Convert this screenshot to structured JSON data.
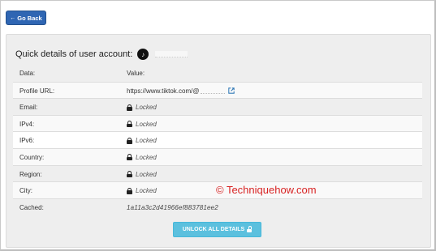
{
  "nav": {
    "back_label": "Go Back",
    "back_icon": "arrow-left-icon"
  },
  "panel": {
    "title": "Quick details of user account:",
    "account_logo": "tiktok-logo",
    "rows": [
      {
        "key": "Data:",
        "value": "Value:"
      },
      {
        "key": "Profile URL:",
        "value": "https://www.tiktok.com/@"
      },
      {
        "key": "Email:",
        "value": "Locked"
      },
      {
        "key": "IPv4:",
        "value": "Locked"
      },
      {
        "key": "IPv6:",
        "value": "Locked"
      },
      {
        "key": "Country:",
        "value": "Locked"
      },
      {
        "key": "Region:",
        "value": "Locked"
      },
      {
        "key": "City:",
        "value": "Locked"
      },
      {
        "key": "Cached:",
        "value": "1a11a3c2d41966ef883781ee2"
      }
    ],
    "unlock_label": "UNLOCK ALL DETAILS"
  },
  "watermark": "© Techniquehow.com",
  "colors": {
    "back_button": "#2f66b3",
    "unlock_button": "#5bc0de",
    "panel_bg": "#eeeeee",
    "watermark": "#d82424",
    "link_icon": "#337ab7"
  }
}
